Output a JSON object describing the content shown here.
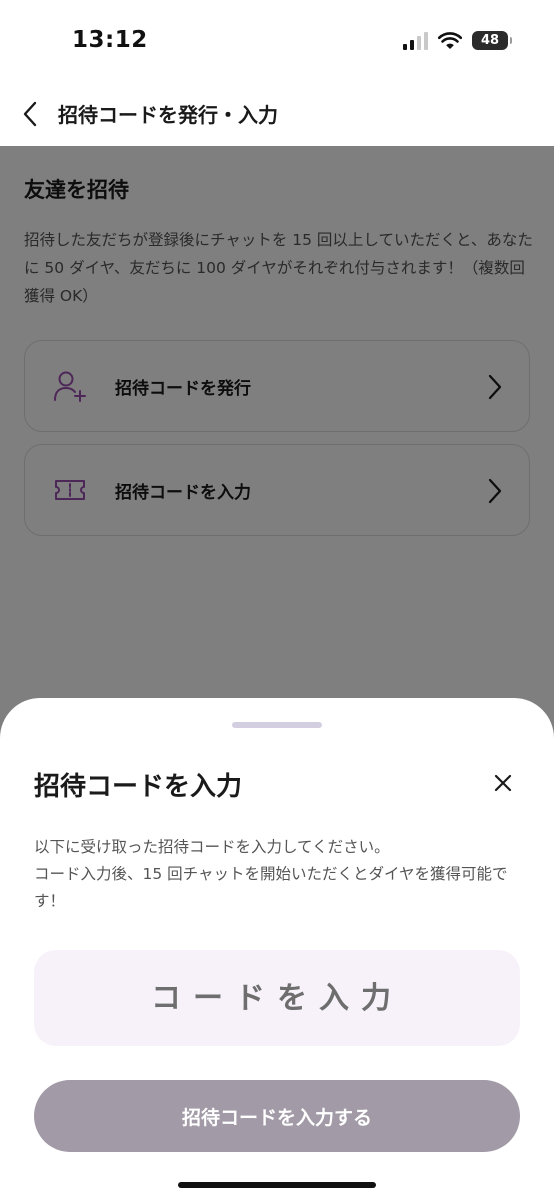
{
  "status_bar": {
    "time": "13:12",
    "battery": "48",
    "icons": [
      "signal-icon",
      "wifi-icon",
      "battery-icon"
    ]
  },
  "header": {
    "title": "招待コードを発行・入力",
    "back_icon": "chevron-left-icon"
  },
  "invite_section": {
    "title": "友達を招待",
    "description": "招待した友だちが登録後にチャットを 15 回以上していただくと、あなたに 50 ダイヤ、友だちに 100 ダイヤがそれぞれ付与されます！（複数回獲得 OK）",
    "options": [
      {
        "label": "招待コードを発行",
        "icon": "add-user-icon"
      },
      {
        "label": "招待コードを入力",
        "icon": "ticket-icon"
      }
    ]
  },
  "sheet": {
    "title": "招待コードを入力",
    "description_line1": "以下に受け取った招待コードを入力してください。",
    "description_line2": "コード入力後、15 回チャットを開始いただくとダイヤを獲得可能です！",
    "input_placeholder": "コードを入力",
    "input_value": "",
    "submit_label": "招待コードを入力する"
  },
  "colors": {
    "accent_purple": "#9b4fb0",
    "input_bg": "#f7f2fa",
    "button_disabled": "#a29aa6"
  }
}
